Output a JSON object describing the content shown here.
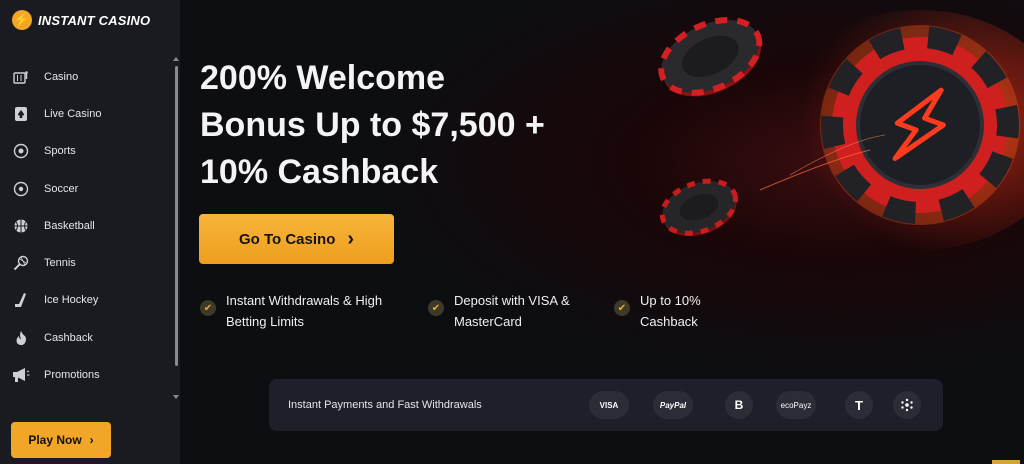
{
  "brand": {
    "name": "INSTANT CASINO",
    "accent": "#f2a627"
  },
  "sidebar": {
    "items": [
      {
        "label": "Casino",
        "icon": "slot-machine-icon"
      },
      {
        "label": "Live Casino",
        "icon": "spade-card-icon"
      },
      {
        "label": "Sports",
        "icon": "sports-ball-icon"
      },
      {
        "label": "Soccer",
        "icon": "soccer-ball-icon"
      },
      {
        "label": "Basketball",
        "icon": "basketball-icon"
      },
      {
        "label": "Tennis",
        "icon": "tennis-racket-icon"
      },
      {
        "label": "Ice Hockey",
        "icon": "hockey-stick-icon"
      },
      {
        "label": "Cashback",
        "icon": "flame-icon"
      },
      {
        "label": "Promotions",
        "icon": "megaphone-icon"
      }
    ],
    "play_button": "Play Now"
  },
  "hero": {
    "headline_line1": "200% Welcome",
    "headline_line2": "Bonus Up to $7,500 +",
    "headline_line3": "10% Cashback",
    "cta_label": "Go To Casino"
  },
  "features": [
    {
      "line1": "Instant Withdrawals & High",
      "line2": "Betting Limits"
    },
    {
      "line1": "Deposit with VISA &",
      "line2": "MasterCard"
    },
    {
      "line1": "Up to 10%",
      "line2": "Cashback"
    }
  ],
  "payments": {
    "label": "Instant Payments and Fast Withdrawals",
    "methods": [
      "VISA",
      "PayPal",
      "B",
      "ecoPayz",
      "T",
      "ADA"
    ]
  }
}
